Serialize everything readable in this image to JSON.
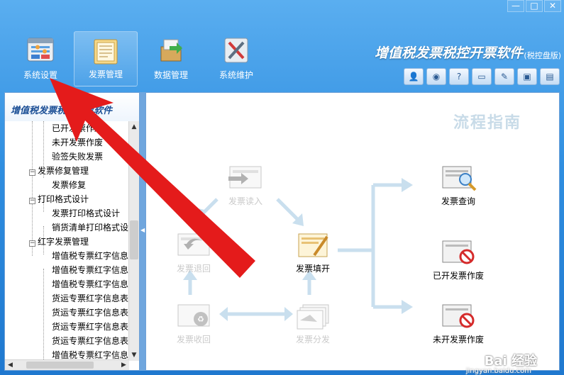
{
  "window": {
    "minimize": "—",
    "maximize": "□",
    "close": "✕"
  },
  "toolbar": {
    "items": [
      {
        "label": "系统设置",
        "icon": "settings-panel-icon"
      },
      {
        "label": "发票管理",
        "icon": "invoice-folder-icon"
      },
      {
        "label": "数据管理",
        "icon": "data-box-icon"
      },
      {
        "label": "系统维护",
        "icon": "tools-icon"
      }
    ]
  },
  "app": {
    "title": "增值税发票税控开票软件",
    "subtitle": "(税控盘版)"
  },
  "mini_toolbar": {
    "items": [
      {
        "icon": "user-icon",
        "glyph": "👤"
      },
      {
        "icon": "globe-icon",
        "glyph": "◉"
      },
      {
        "icon": "help-icon",
        "glyph": "?"
      },
      {
        "icon": "window-icon",
        "glyph": "▭"
      },
      {
        "icon": "pen-icon",
        "glyph": "✎"
      },
      {
        "icon": "lock-icon",
        "glyph": "▣"
      },
      {
        "icon": "clipboard-icon",
        "glyph": "▤"
      }
    ]
  },
  "sidebar": {
    "title": "增值税发票税控开票软件",
    "items": [
      {
        "label": "已开发票作废",
        "level": 2
      },
      {
        "label": "未开发票作废",
        "level": 2
      },
      {
        "label": "验签失败发票",
        "level": 2
      },
      {
        "label": "发票修复管理",
        "level": 1,
        "expander": "−"
      },
      {
        "label": "发票修复",
        "level": 2
      },
      {
        "label": "打印格式设计",
        "level": 1,
        "expander": "−"
      },
      {
        "label": "发票打印格式设计",
        "level": 2
      },
      {
        "label": "销货清单打印格式设",
        "level": 2
      },
      {
        "label": "红字发票管理",
        "level": 1,
        "expander": "−"
      },
      {
        "label": "增值税专票红字信息",
        "level": 2
      },
      {
        "label": "增值税专票红字信息",
        "level": 2
      },
      {
        "label": "增值税专票红字信息",
        "level": 2
      },
      {
        "label": "货运专票红字信息表",
        "level": 2
      },
      {
        "label": "货运专票红字信息表",
        "level": 2
      },
      {
        "label": "货运专票红字信息表",
        "level": 2
      },
      {
        "label": "货运专票红字信息表",
        "level": 2
      },
      {
        "label": "增值税专票红字信息",
        "level": 2
      }
    ],
    "scroll_up": "▲",
    "scroll_down": "▼",
    "scroll_left": "◀",
    "scroll_right": "▶"
  },
  "canvas": {
    "guide_title": "流程指南",
    "nodes": {
      "read_in": "发票读入",
      "return": "发票退回",
      "receive": "发票收回",
      "fill": "发票填开",
      "distribute": "发票分发",
      "query": "发票查询",
      "void_issued": "已开发票作废",
      "void_unissued": "未开发票作废"
    }
  },
  "watermark": {
    "text": "Bai 经验",
    "url": "jingyan.baidu.com"
  },
  "colors": {
    "chrome": "#2f8ee0",
    "arrow": "#e41b1b",
    "flow_arrow": "#c9dfee"
  }
}
